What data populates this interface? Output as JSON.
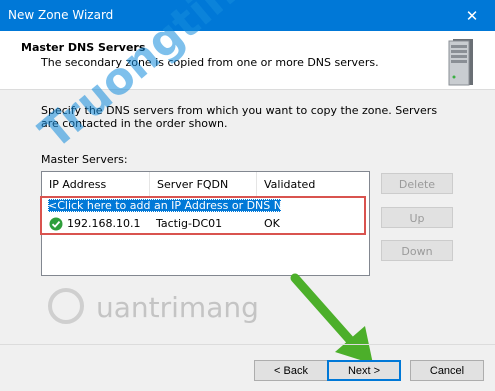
{
  "window": {
    "title": "New Zone Wizard",
    "close_glyph": "✕"
  },
  "header": {
    "title": "Master DNS Servers",
    "subtitle": "The secondary zone is copied from one or more DNS servers.",
    "icon": "server-icon"
  },
  "body": {
    "instructions": "Specify the DNS servers from which you want to copy the zone.  Servers are contacted in the order shown.",
    "master_label": "Master Servers:"
  },
  "list": {
    "columns": [
      "IP Address",
      "Server FQDN",
      "Validated"
    ],
    "add_placeholder": "<Click here to add an IP Address or DNS Name>",
    "rows": [
      {
        "ip": "192.168.10.1",
        "fqdn": "Tactig-DC01",
        "validated": "OK",
        "status_icon": "check-icon"
      }
    ]
  },
  "side_buttons": {
    "delete": "Delete",
    "up": "Up",
    "down": "Down"
  },
  "footer": {
    "back": "< Back",
    "next": "Next >",
    "cancel": "Cancel"
  },
  "watermarks": {
    "diagonal": "Truongtin.top",
    "brand": "uantrimang"
  },
  "colors": {
    "titlebar": "#0078d7",
    "selection": "#0078d7",
    "highlight_box": "#d9534f",
    "arrow": "#4caf2a"
  }
}
